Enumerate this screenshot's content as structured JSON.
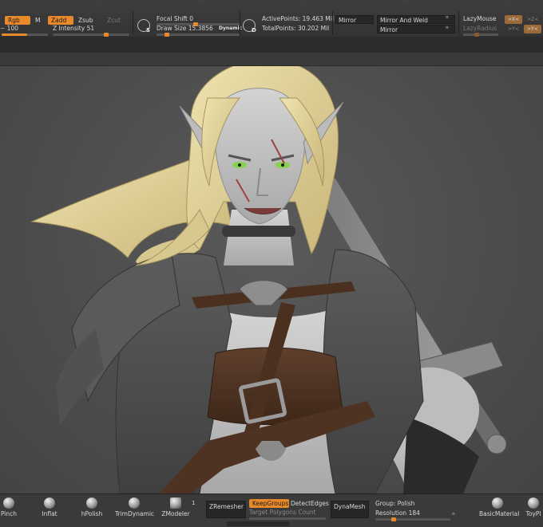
{
  "toolbar": {
    "rgb": "Rgb",
    "m": "M",
    "zadd": "Zadd",
    "zsub": "Zsub",
    "zcut": "Zcut",
    "rgb_intensity_value": "100",
    "rgb_intensity_level": 0.55,
    "z_intensity_label": "Z Intensity",
    "z_intensity_value": "51",
    "z_intensity_level": 0.51,
    "focal_shift_label": "Focal Shift",
    "focal_shift_value": "0",
    "focal_shift_level": 0.5,
    "draw_size_label": "Draw Size",
    "draw_size_value": "15.3856",
    "draw_size_level": 0.1,
    "dynamic": "Dynamic",
    "s_badge": "S",
    "d_badge": "D",
    "active_points_label": "ActivePoints:",
    "active_points_value": "19.463 Mil",
    "total_points_label": "TotalPoints:",
    "total_points_value": "30.202 Mil",
    "mirror_1": "Mirror",
    "mirror_and_weld": "Mirror And Weld",
    "mirror_2": "Mirror",
    "lazy_mouse": "LazyMouse",
    "lazy_radius": "LazyRadius",
    "x_btn_1": ">X<",
    "z_btn": ">Z<",
    "x_btn_2": ">Y<",
    "y_btn": ">Y<"
  },
  "shelf": {
    "pinch": "Pinch",
    "inflat": "Inflat",
    "hpolish": "hPolish",
    "trimdynamic": "TrimDynamic",
    "zmodeler": "ZModeler",
    "zmodeler_count": "1",
    "zremesher": "ZRemesher",
    "keepgroups": "KeepGroups",
    "detectedges": "DetectEdges",
    "target_polygons": "Target Polygons Count",
    "dynamesh": "DynaMesh",
    "group_label": "Group:",
    "group_value": "Polish",
    "resolution_label": "Resolution",
    "resolution_value": "184",
    "basicmaterial": "BasicMaterial",
    "toyplastic": "ToyPl"
  },
  "colors": {
    "accent": "#e8892b",
    "panel": "#3a3a3a",
    "canvas": "#4c4c4c"
  }
}
